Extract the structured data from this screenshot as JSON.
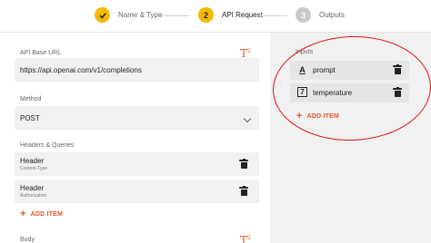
{
  "stepper": {
    "steps": [
      {
        "number": "✓",
        "label": "Name & Type",
        "state": "done"
      },
      {
        "number": "2",
        "label": "API Request",
        "state": "active"
      },
      {
        "number": "3",
        "label": "Outputs",
        "state": "pending"
      }
    ]
  },
  "form": {
    "api_base_url": {
      "label": "API Base URL",
      "value": "https://api.openai.com/v1/completions"
    },
    "method": {
      "label": "Method",
      "value": "POST"
    },
    "headers_queries": {
      "label": "Headers & Queries",
      "items": [
        {
          "title": "Header",
          "subtitle": "Content-Type"
        },
        {
          "title": "Header",
          "subtitle": "Authorization"
        }
      ],
      "add_label": "ADD ITEM"
    },
    "body": {
      "label": "Body"
    },
    "template_icon": "T",
    "template_icon_sup": "2"
  },
  "inputs": {
    "label": "Inputs",
    "items": [
      {
        "icon": "text-icon",
        "glyph": "A",
        "name": "prompt"
      },
      {
        "icon": "number-icon",
        "glyph": "7",
        "name": "temperature"
      }
    ],
    "add_label": "ADD ITEM"
  },
  "colors": {
    "accent": "#f5b800",
    "add": "#e4542a",
    "annotation": "#e01010",
    "panel": "#f1f1f1"
  }
}
